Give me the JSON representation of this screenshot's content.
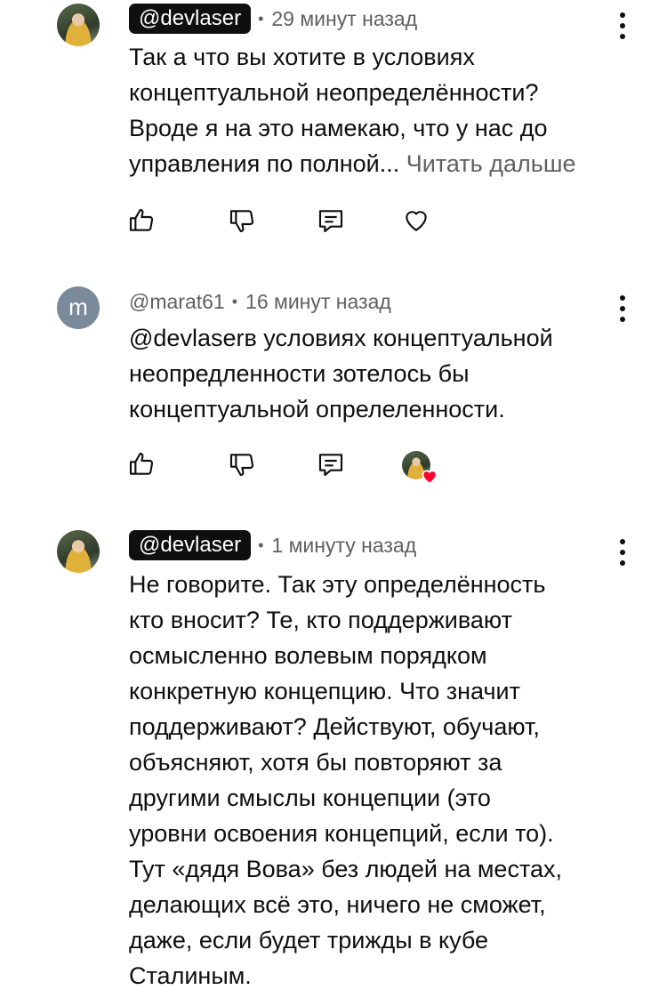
{
  "comments": [
    {
      "handle": "@devlaser",
      "separator": "•",
      "time": "29 минут назад",
      "lines": [
        "Так а что вы хотите в условиях",
        "концептуальной неопределённости?",
        "Вроде я на это намекаю, что у нас до",
        "управления по полной..."
      ],
      "read_more": "Читать дальше",
      "avatar_icon": "user-photo-avatar"
    },
    {
      "handle": "@marat61",
      "separator": "•",
      "time": "16 минут назад",
      "avatar_letter": "m",
      "lines": [
        "@devlaserв условиях концептуальной",
        "неопредленности зотелось бы",
        "концептуальной опрелеленности."
      ]
    },
    {
      "handle": "@devlaser",
      "separator": "•",
      "time": "1 минуту назад",
      "avatar_icon": "user-photo-avatar",
      "lines": [
        "Не говорите. Так эту определённость",
        "кто вносит? Те, кто поддерживают",
        "осмысленно волевым порядком",
        "конкретную концепцию. Что значит",
        "поддерживают? Действуют, обучают,",
        "объясняют, хотя бы повторяют за",
        "другими смыслы концепции (это",
        "уровни освоения концепций, если то).",
        "Тут «дядя Вова» без людей на местах,",
        "делающих всё это, ничего не сможет,",
        "даже, если будет трижды в кубе",
        "Сталиным."
      ]
    }
  ],
  "icons": {
    "like": "thumbs-up-icon",
    "dislike": "thumbs-down-icon",
    "reply": "reply-icon",
    "heart": "heart-icon",
    "menu": "more-vertical-icon"
  },
  "colors": {
    "text": "#0f0f0f",
    "secondary": "#606060",
    "badge_bg": "#0f0f0f",
    "heart_red": "#ff0033"
  }
}
